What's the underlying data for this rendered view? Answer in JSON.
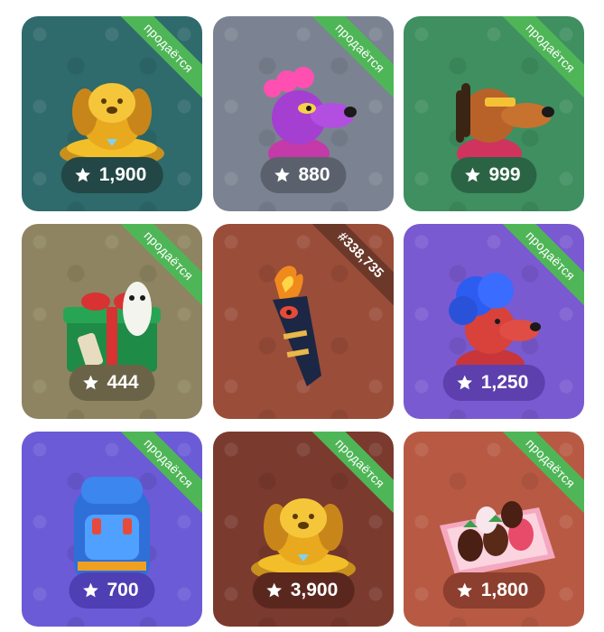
{
  "gifts": [
    {
      "name": "golden-dog",
      "price": "1,900",
      "ribbon": "продаётся",
      "ribbon_style": "green",
      "bg": "#2f6a6c",
      "pill": "#224746",
      "art": "golden-dog-icon"
    },
    {
      "name": "purple-dog",
      "price": "880",
      "ribbon": "продаётся",
      "ribbon_style": "green",
      "bg": "#7b8392",
      "pill": "#5b616c",
      "art": "purple-dog-icon"
    },
    {
      "name": "dreadlock-dog",
      "price": "999",
      "ribbon": "продаётся",
      "ribbon_style": "green",
      "bg": "#3f8f61",
      "pill": "#2b6444",
      "art": "dreadlock-dog-icon"
    },
    {
      "name": "gift-box",
      "price": "444",
      "ribbon": "продаётся",
      "ribbon_style": "green",
      "bg": "#8e8461",
      "pill": "#6b6347",
      "art": "gift-box-icon"
    },
    {
      "name": "torch",
      "price": "",
      "ribbon": "#338,735",
      "ribbon_style": "dark",
      "bg": "#9a4d38",
      "pill": "",
      "art": "torch-icon"
    },
    {
      "name": "blue-hair-dog",
      "price": "1,250",
      "ribbon": "продаётся",
      "ribbon_style": "green",
      "bg": "#7a5ad0",
      "pill": "#5d3fae",
      "art": "blue-hair-dog-icon"
    },
    {
      "name": "backpack",
      "price": "700",
      "ribbon": "продаётся",
      "ribbon_style": "green",
      "bg": "#6b5bd6",
      "pill": "#4f3fb5",
      "art": "backpack-icon"
    },
    {
      "name": "golden-dog-2",
      "price": "3,900",
      "ribbon": "продаётся",
      "ribbon_style": "green",
      "bg": "#7b3a2e",
      "pill": "#5a271f",
      "art": "golden-dog-icon"
    },
    {
      "name": "strawberries",
      "price": "1,800",
      "ribbon": "продаётся",
      "ribbon_style": "green",
      "bg": "#b85a43",
      "pill": "#8c3f2e",
      "art": "chocolate-strawberries-icon"
    }
  ]
}
